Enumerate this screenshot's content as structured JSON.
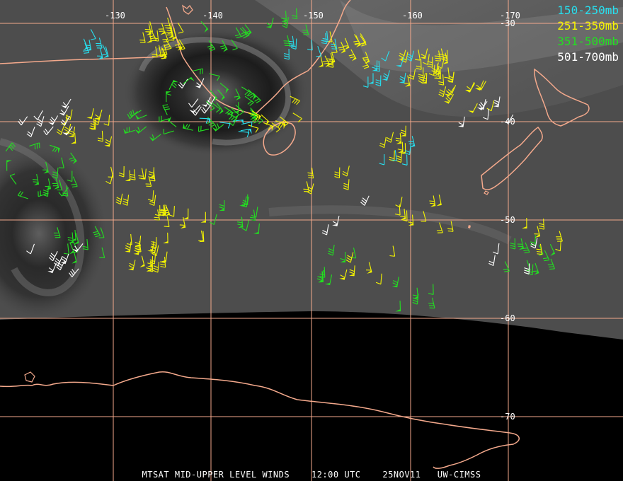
{
  "colors": {
    "grid": "#f4a98c",
    "coast": "#f4a98c",
    "band_150_250": "#27e0f0",
    "band_251_350": "#f5f500",
    "band_351_500": "#22e020",
    "band_501_700": "#ffffff"
  },
  "legend": [
    {
      "label": "150-250mb",
      "color": "#27e0f0"
    },
    {
      "label": "251-350mb",
      "color": "#f5f500"
    },
    {
      "label": "351-500mb",
      "color": "#22e020"
    },
    {
      "label": "501-700mb",
      "color": "#ffffff"
    }
  ],
  "longitude_labels": [
    "-130",
    "-140",
    "-150",
    "-160",
    "-170"
  ],
  "latitude_labels": [
    "-30",
    "-40",
    "-50",
    "-60",
    "-70"
  ],
  "footer": {
    "product": "MTSAT MID-UPPER LEVEL WINDS",
    "time": "12:00 UTC",
    "date": "25NOV11",
    "source": "UW-CIMSS"
  },
  "wind_clusters": [
    {
      "band": "band_251_350",
      "lat": -31,
      "lon": -135,
      "n": 22,
      "dir": 250
    },
    {
      "band": "band_150_250",
      "lat": -31,
      "lon": -128,
      "n": 8,
      "dir": 250
    },
    {
      "band": "band_351_500",
      "lat": -31,
      "lon": -141,
      "n": 8,
      "dir": 240
    },
    {
      "band": "band_251_350",
      "lat": -32,
      "lon": -153,
      "n": 16,
      "dir": 250
    },
    {
      "band": "band_150_250",
      "lat": -31,
      "lon": -150,
      "n": 8,
      "dir": 260
    },
    {
      "band": "band_251_350",
      "lat": -34,
      "lon": -162,
      "n": 26,
      "dir": 270
    },
    {
      "band": "band_150_250",
      "lat": -34,
      "lon": -158,
      "n": 10,
      "dir": 280
    },
    {
      "band": "band_351_500",
      "lat": -30,
      "lon": -148,
      "n": 6,
      "dir": 270
    },
    {
      "band": "band_251_350",
      "lat": -37,
      "lon": -166,
      "n": 10,
      "dir": 290
    },
    {
      "band": "band_501_700",
      "lat": -38,
      "lon": -168,
      "n": 6,
      "dir": 290
    },
    {
      "band": "band_501_700",
      "lat": -37,
      "lon": -138,
      "n": 8,
      "dir": 300
    },
    {
      "band": "band_351_500",
      "lat": -38,
      "lon": -142,
      "n": 18,
      "dir": 220
    },
    {
      "band": "band_251_350",
      "lat": -39,
      "lon": -146,
      "n": 10,
      "dir": 210
    },
    {
      "band": "band_150_250",
      "lat": -41,
      "lon": -141,
      "n": 6,
      "dir": 180
    },
    {
      "band": "band_351_500",
      "lat": -40,
      "lon": -134,
      "n": 8,
      "dir": 330
    },
    {
      "band": "band_251_350",
      "lat": -40,
      "lon": -127,
      "n": 14,
      "dir": 280
    },
    {
      "band": "band_501_700",
      "lat": -39,
      "lon": -123,
      "n": 10,
      "dir": 300
    },
    {
      "band": "band_251_350",
      "lat": -42,
      "lon": -159,
      "n": 8,
      "dir": 270
    },
    {
      "band": "band_150_250",
      "lat": -42,
      "lon": -158,
      "n": 5,
      "dir": 270
    },
    {
      "band": "band_251_350",
      "lat": -46,
      "lon": -152,
      "n": 6,
      "dir": 270
    },
    {
      "band": "band_351_500",
      "lat": -45,
      "lon": -124,
      "n": 10,
      "dir": 260
    },
    {
      "band": "band_251_350",
      "lat": -46,
      "lon": -132,
      "n": 14,
      "dir": 270
    },
    {
      "band": "band_351_500",
      "lat": -49,
      "lon": -143,
      "n": 10,
      "dir": 270
    },
    {
      "band": "band_251_350",
      "lat": -50,
      "lon": -137,
      "n": 14,
      "dir": 260
    },
    {
      "band": "band_351_500",
      "lat": -52,
      "lon": -126,
      "n": 12,
      "dir": 250
    },
    {
      "band": "band_251_350",
      "lat": -53,
      "lon": -133,
      "n": 18,
      "dir": 270
    },
    {
      "band": "band_501_700",
      "lat": -54,
      "lon": -124,
      "n": 8,
      "dir": 300
    },
    {
      "band": "band_251_350",
      "lat": -48,
      "lon": -161,
      "n": 6,
      "dir": 270
    },
    {
      "band": "band_351_500",
      "lat": -54,
      "lon": -153,
      "n": 8,
      "dir": 270
    },
    {
      "band": "band_251_350",
      "lat": -54,
      "lon": -156,
      "n": 6,
      "dir": 270
    },
    {
      "band": "band_351_500",
      "lat": -57,
      "lon": -160,
      "n": 6,
      "dir": 270
    },
    {
      "band": "band_351_500",
      "lat": -53,
      "lon": -172,
      "n": 12,
      "dir": 260
    },
    {
      "band": "band_251_350",
      "lat": -51,
      "lon": -173,
      "n": 6,
      "dir": 260
    },
    {
      "band": "band_501_700",
      "lat": -53,
      "lon": -171,
      "n": 4,
      "dir": 270
    },
    {
      "band": "band_501_700",
      "lat": -49,
      "lon": -154,
      "n": 3,
      "dir": 280
    },
    {
      "band": "band_251_350",
      "lat": -49,
      "lon": -163,
      "n": 4,
      "dir": 260
    }
  ],
  "gust_swirls": [
    {
      "band": "band_351_500",
      "lat": -45,
      "lon": -122,
      "n": 10
    },
    {
      "band": "band_351_500",
      "lat": -38,
      "lon": -139,
      "n": 14
    }
  ]
}
